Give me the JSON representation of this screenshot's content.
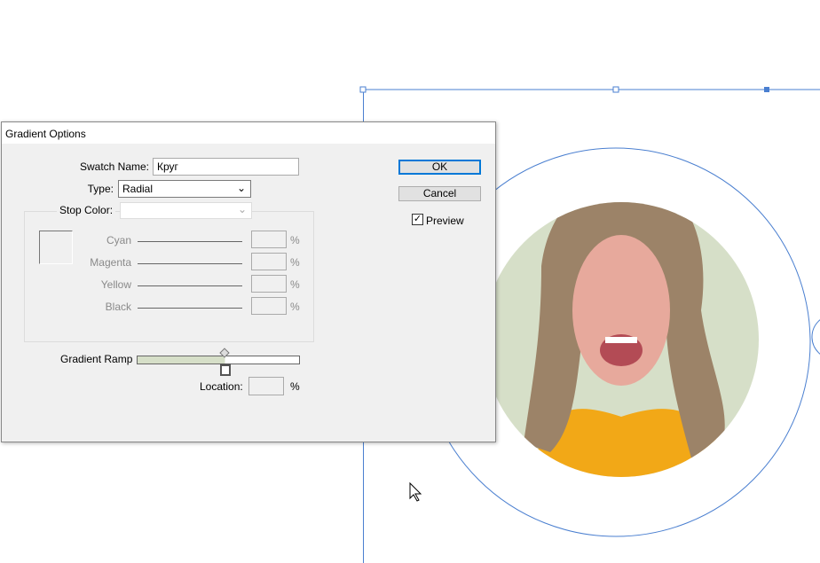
{
  "dialog": {
    "title": "Gradient Options",
    "swatch_name_label": "Swatch Name:",
    "swatch_name_value": "Круг",
    "type_label": "Type:",
    "type_value": "Radial",
    "stop_color_label": "Stop Color:",
    "stop_color_value": "",
    "channels": [
      {
        "label": "Cyan",
        "value": ""
      },
      {
        "label": "Magenta",
        "value": ""
      },
      {
        "label": "Yellow",
        "value": ""
      },
      {
        "label": "Black",
        "value": ""
      }
    ],
    "percent": "%",
    "ramp_label": "Gradient Ramp",
    "location_label": "Location:",
    "location_value": "",
    "ok": "OK",
    "cancel": "Cancel",
    "preview_label": "Preview",
    "preview_checked": true,
    "ramp_color": "#d6dfc8"
  }
}
